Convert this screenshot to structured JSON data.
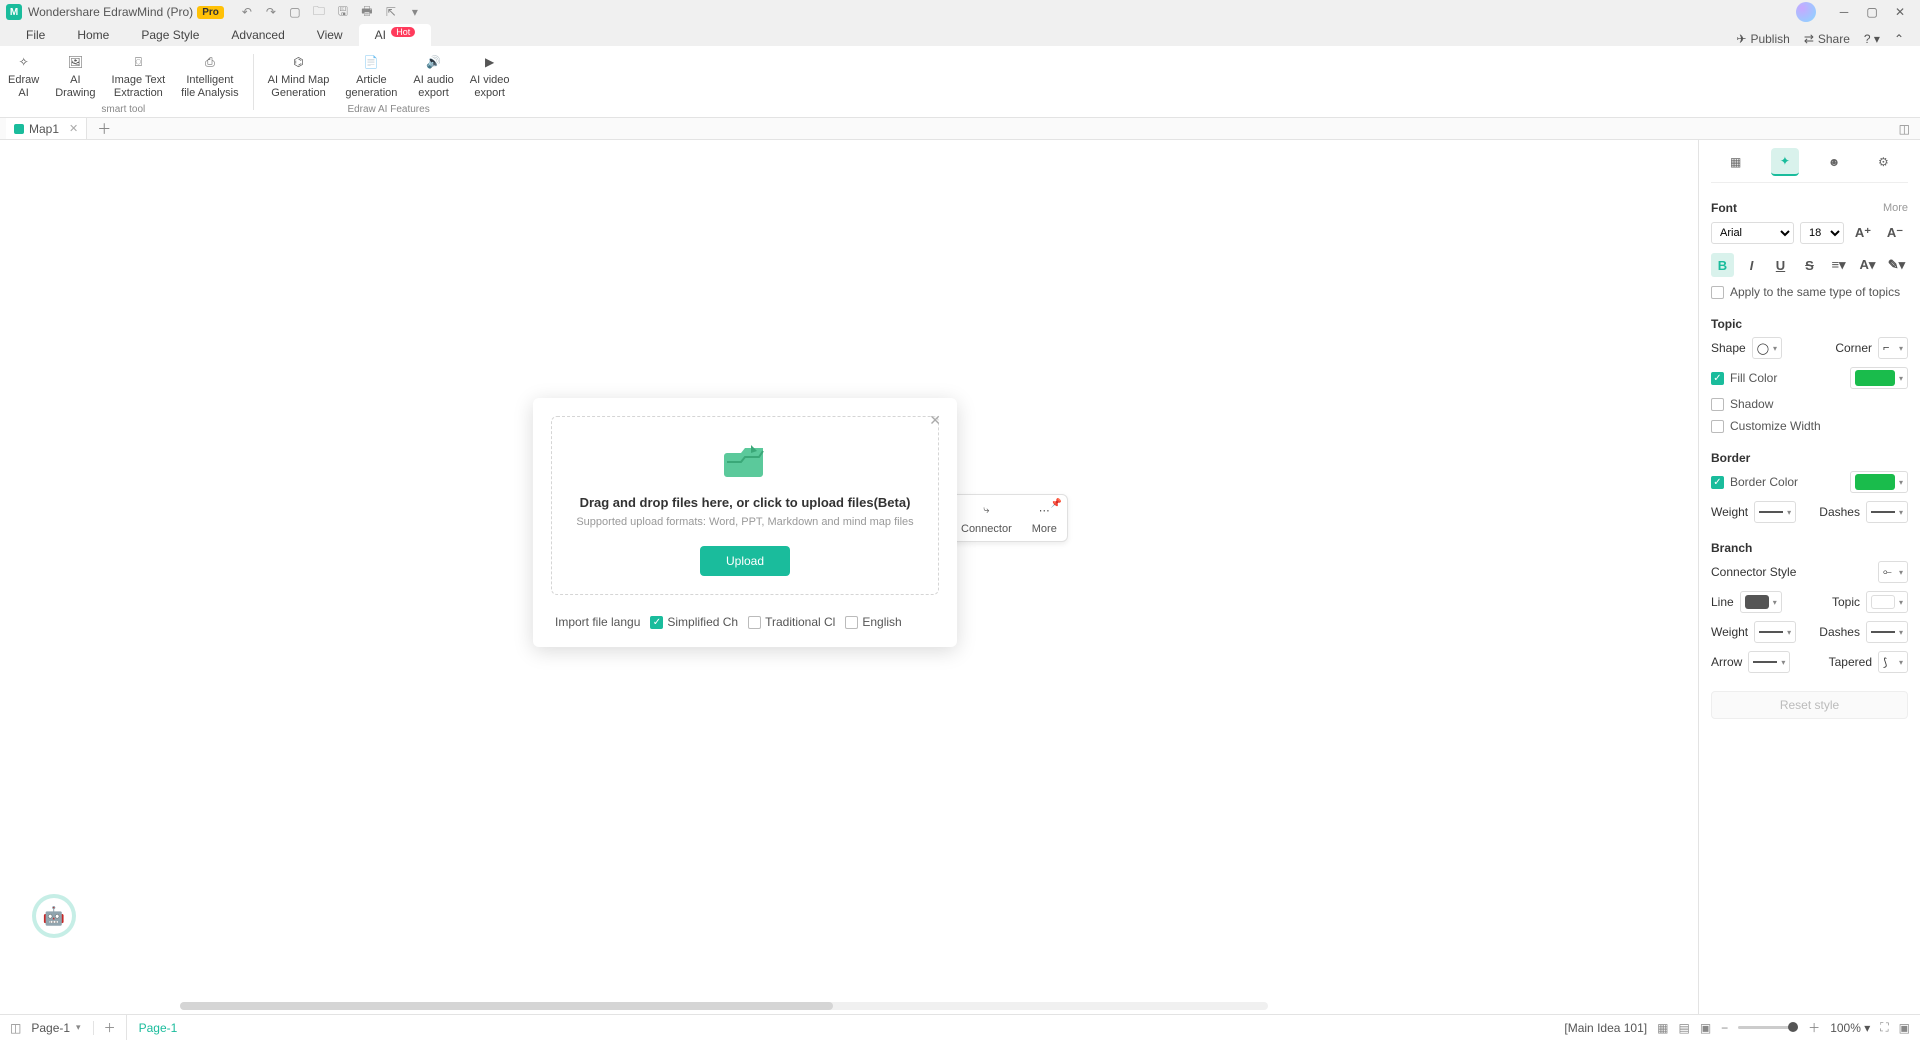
{
  "titlebar": {
    "app_name": "Wondershare EdrawMind (Pro)",
    "pro_badge": "Pro"
  },
  "menu": {
    "items": [
      "File",
      "Home",
      "Page Style",
      "Advanced",
      "View",
      "AI"
    ],
    "hot_badge": "Hot",
    "publish": "Publish",
    "share": "Share"
  },
  "ribbon": {
    "group1_label": "smart tool",
    "group2_label": "Edraw AI Features",
    "tools": [
      "Edraw\nAI",
      "AI\nDrawing",
      "Image Text\nExtraction",
      "Intelligent\nfile Analysis",
      "AI Mind Map\nGeneration",
      "Article\ngeneration",
      "AI audio\nexport",
      "AI video\nexport"
    ]
  },
  "tabs": {
    "doc_tab": "Map1"
  },
  "float_toolbar": {
    "connector": "Connector",
    "more": "More"
  },
  "modal": {
    "title": "Drag and drop files here, or click to upload files(Beta)",
    "subtitle": "Supported upload formats: Word, PPT, Markdown and mind map files",
    "upload_btn": "Upload",
    "lang_label": "Import file langu",
    "lang_simplified": "Simplified Ch",
    "lang_traditional": "Traditional Cl",
    "lang_english": "English"
  },
  "rpanel": {
    "font": {
      "title": "Font",
      "more": "More",
      "family": "Arial",
      "size": "18",
      "apply_same": "Apply to the same type of topics"
    },
    "topic": {
      "title": "Topic",
      "shape": "Shape",
      "corner": "Corner",
      "fill_color": "Fill Color",
      "fill_hex": "#1abc4c",
      "shadow": "Shadow",
      "customize_width": "Customize Width"
    },
    "border": {
      "title": "Border",
      "border_color": "Border Color",
      "border_hex": "#1abc4c",
      "weight": "Weight",
      "dashes": "Dashes"
    },
    "branch": {
      "title": "Branch",
      "connector_style": "Connector Style",
      "line": "Line",
      "topic": "Topic",
      "weight": "Weight",
      "dashes": "Dashes",
      "arrow": "Arrow",
      "tapered": "Tapered"
    },
    "reset": "Reset style"
  },
  "statusbar": {
    "page_dropdown": "Page-1",
    "page_tab": "Page-1",
    "main_idea": "[Main Idea 101]",
    "zoom": "100%"
  }
}
